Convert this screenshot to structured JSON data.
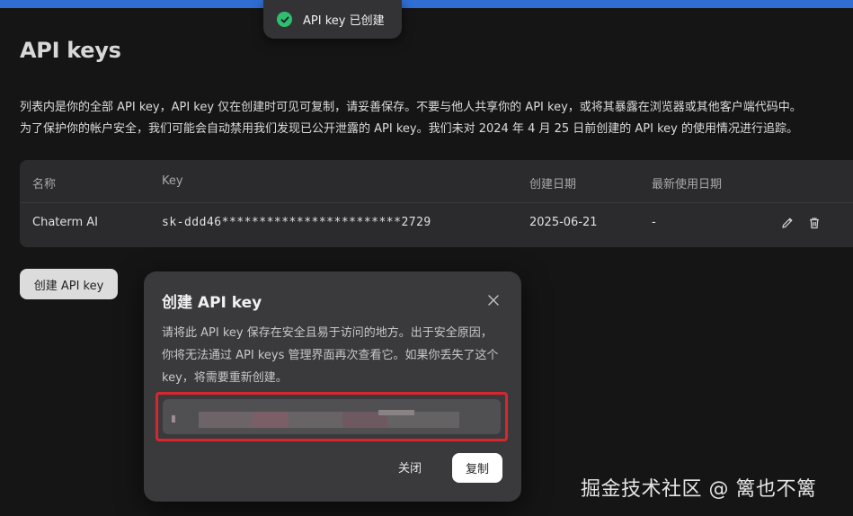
{
  "toast": {
    "text": "API key 已创建",
    "icon": "check-circle-icon"
  },
  "page": {
    "title": "API keys",
    "description_lines": [
      "列表内是你的全部 API key，API key 仅在创建时可见可复制，请妥善保存。不要与他人共享你的 API key，或将其暴露在浏览器或其他客户端代码中。",
      "为了保护你的帐户安全，我们可能会自动禁用我们发现已公开泄露的 API key。我们未对 2024 年 4 月 25 日前创建的 API key 的使用情况进行追踪。"
    ]
  },
  "table": {
    "headers": {
      "name": "名称",
      "key": "Key",
      "created": "创建日期",
      "last_used": "最新使用日期"
    },
    "rows": [
      {
        "name": "Chaterm AI",
        "key": "sk-ddd46************************2729",
        "created": "2025-06-21",
        "last_used": "-"
      }
    ]
  },
  "buttons": {
    "create": "创建 API key"
  },
  "modal": {
    "title": "创建 API key",
    "body": "请将此 API key 保存在安全且易于访问的地方。出于安全原因，你将无法通过 API keys 管理界面再次查看它。如果你丢失了这个 key，将需要重新创建。",
    "close_label": "关闭",
    "copy_label": "复制"
  },
  "watermark": "掘金技术社区 @ 篱也不篱",
  "colors": {
    "accent": "#2f6fd3",
    "success": "#2fbf71",
    "highlight": "#d8262e"
  }
}
